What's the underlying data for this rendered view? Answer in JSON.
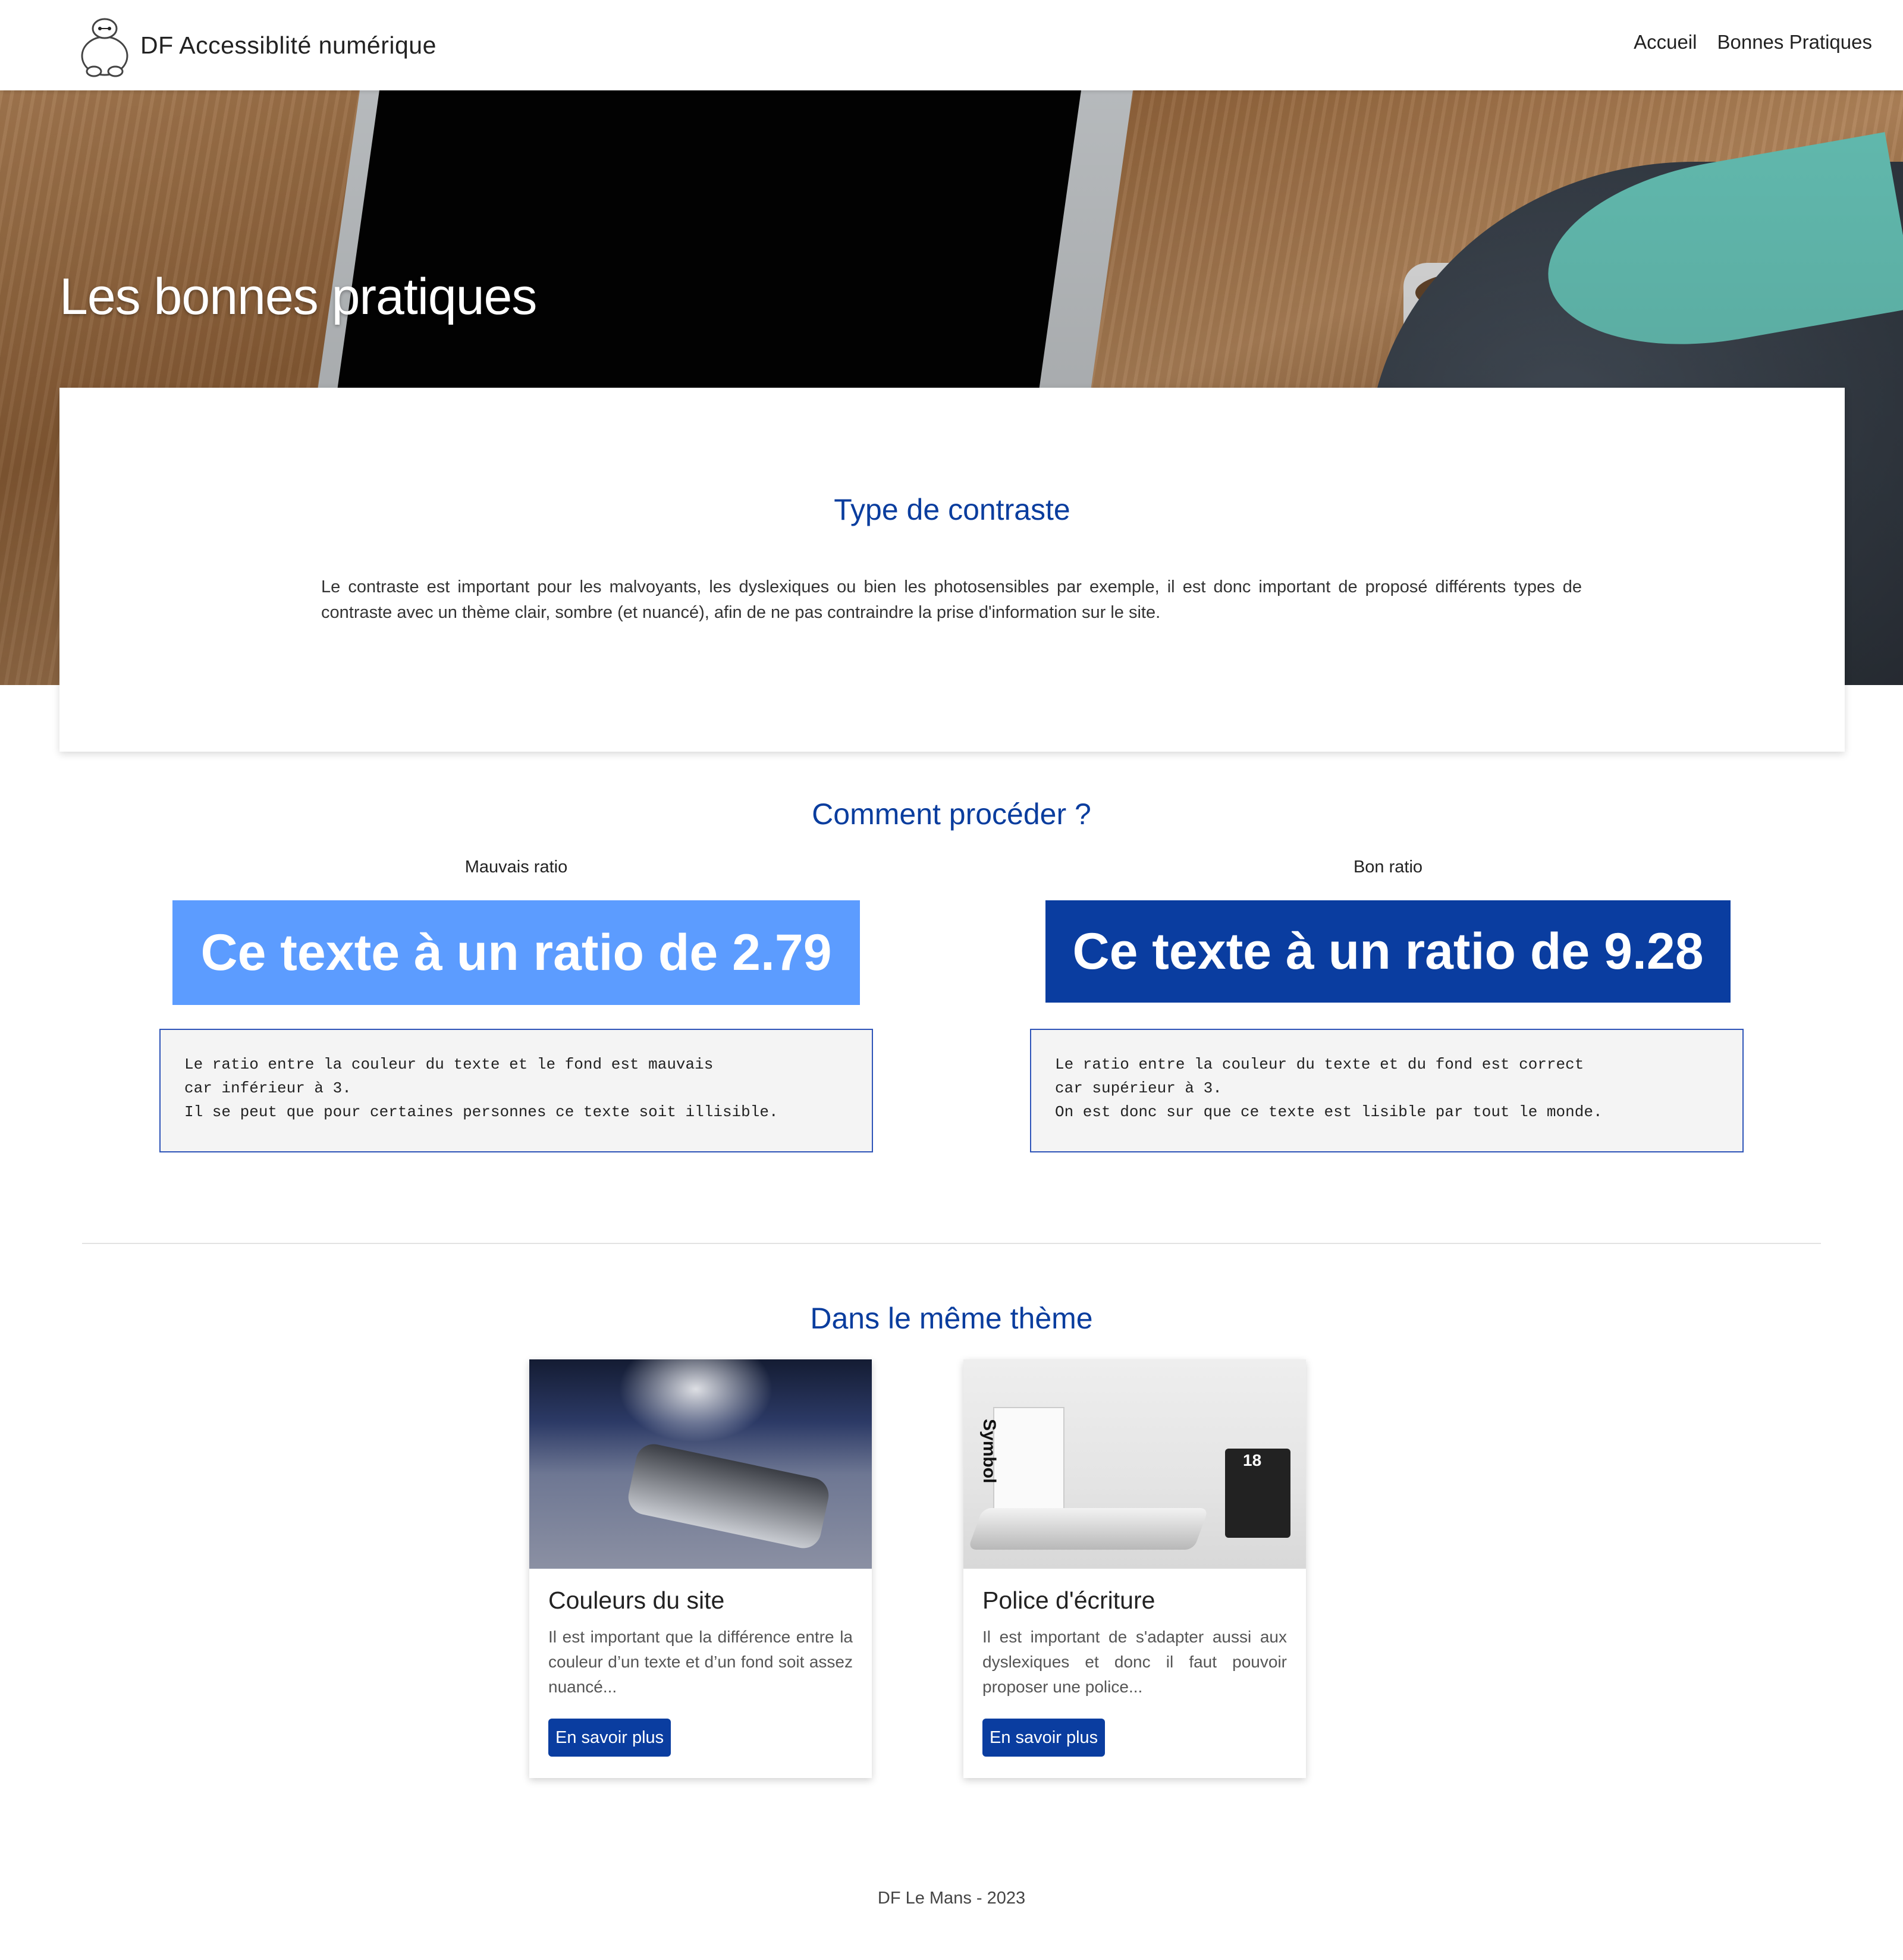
{
  "header": {
    "brand": "DF Accessiblité numérique",
    "nav": [
      "Accueil",
      "Bonnes Pratiques"
    ]
  },
  "hero": {
    "title": "Les bonnes pratiques"
  },
  "intro": {
    "title": "Type de contraste",
    "text": "Le contraste est important pour les malvoyants, les dyslexiques ou bien les photosensibles par exemple, il est donc important de proposé différents types de contraste avec un thème clair, sombre (et nuancé), afin de ne pas contraindre la prise d'information sur le site."
  },
  "how": {
    "title": "Comment procéder ?",
    "bad": {
      "label": "Mauvais ratio",
      "sample": "Ce texte à un ratio de 2.79",
      "sample_bg": "#5c9cff",
      "code": "Le ratio entre la couleur du texte et le fond est mauvais\ncar inférieur à 3.\nIl se peut que pour certaines personnes ce texte soit illisible."
    },
    "good": {
      "label": "Bon ratio",
      "sample": "Ce texte à un ratio de 9.28",
      "sample_bg": "#0a3da0",
      "code": "Le ratio entre la couleur du texte et du fond est correct\ncar supérieur à 3.\nOn est donc sur que ce texte est lisible par tout le monde."
    }
  },
  "related": {
    "title": "Dans le même thème",
    "cards": [
      {
        "title": "Couleurs du site",
        "text": "Il est important que la différence entre la couleur d’un texte et d’un fond soit assez nuancé...",
        "button": "En savoir plus"
      },
      {
        "title": "Police d'écriture",
        "text": "Il est important de s'adapter aussi aux dyslexiques et donc il faut pouvoir proposer une police...",
        "button": "En savoir plus",
        "image_text": [
          "Symbol",
          "18"
        ]
      }
    ]
  },
  "footer": {
    "text": "DF Le Mans - 2023"
  },
  "colors": {
    "accent": "#0a3da0",
    "title": "#0a3d9e"
  }
}
